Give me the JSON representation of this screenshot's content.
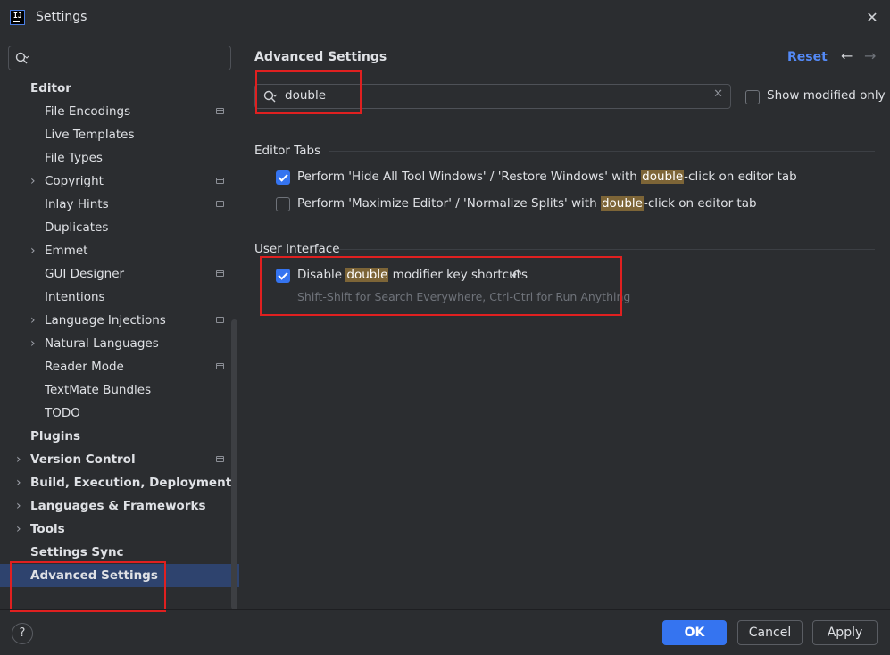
{
  "window": {
    "title": "Settings",
    "logo_text": "IJ"
  },
  "sidebar": {
    "search_placeholder": "",
    "items": [
      {
        "label": "Editor",
        "level": 0,
        "bold": true,
        "chevron": false,
        "project": false
      },
      {
        "label": "File Encodings",
        "level": 1,
        "bold": false,
        "chevron": false,
        "project": true
      },
      {
        "label": "Live Templates",
        "level": 1,
        "bold": false,
        "chevron": false,
        "project": false
      },
      {
        "label": "File Types",
        "level": 1,
        "bold": false,
        "chevron": false,
        "project": false
      },
      {
        "label": "Copyright",
        "level": 1,
        "bold": false,
        "chevron": true,
        "project": true
      },
      {
        "label": "Inlay Hints",
        "level": 1,
        "bold": false,
        "chevron": false,
        "project": true
      },
      {
        "label": "Duplicates",
        "level": 1,
        "bold": false,
        "chevron": false,
        "project": false
      },
      {
        "label": "Emmet",
        "level": 1,
        "bold": false,
        "chevron": true,
        "project": false
      },
      {
        "label": "GUI Designer",
        "level": 1,
        "bold": false,
        "chevron": false,
        "project": true
      },
      {
        "label": "Intentions",
        "level": 1,
        "bold": false,
        "chevron": false,
        "project": false
      },
      {
        "label": "Language Injections",
        "level": 1,
        "bold": false,
        "chevron": true,
        "project": true
      },
      {
        "label": "Natural Languages",
        "level": 1,
        "bold": false,
        "chevron": true,
        "project": false
      },
      {
        "label": "Reader Mode",
        "level": 1,
        "bold": false,
        "chevron": false,
        "project": true
      },
      {
        "label": "TextMate Bundles",
        "level": 1,
        "bold": false,
        "chevron": false,
        "project": false
      },
      {
        "label": "TODO",
        "level": 1,
        "bold": false,
        "chevron": false,
        "project": false
      },
      {
        "label": "Plugins",
        "level": 0,
        "bold": true,
        "chevron": false,
        "project": false
      },
      {
        "label": "Version Control",
        "level": 0,
        "bold": true,
        "chevron": true,
        "project": true
      },
      {
        "label": "Build, Execution, Deployment",
        "level": 0,
        "bold": true,
        "chevron": true,
        "project": false
      },
      {
        "label": "Languages & Frameworks",
        "level": 0,
        "bold": true,
        "chevron": true,
        "project": false
      },
      {
        "label": "Tools",
        "level": 0,
        "bold": true,
        "chevron": true,
        "project": false
      },
      {
        "label": "Settings Sync",
        "level": 0,
        "bold": true,
        "chevron": false,
        "project": false
      },
      {
        "label": "Advanced Settings",
        "level": 0,
        "bold": true,
        "chevron": false,
        "project": false,
        "selected": true
      }
    ]
  },
  "main": {
    "heading": "Advanced Settings",
    "reset": "Reset",
    "search": {
      "value": "double"
    },
    "show_modified_only": {
      "label": "Show modified only",
      "checked": false
    },
    "groups": {
      "editor_tabs": {
        "title": "Editor Tabs",
        "opt1": {
          "checked": true,
          "before": "Perform 'Hide All Tool Windows' / 'Restore Windows' with ",
          "match": "double",
          "after": "-click on editor tab"
        },
        "opt2": {
          "checked": false,
          "before": "Perform 'Maximize Editor' / 'Normalize Splits' with ",
          "match": "double",
          "after": "-click on editor tab"
        }
      },
      "user_interface": {
        "title": "User Interface",
        "opt1": {
          "checked": true,
          "before": "Disable ",
          "match": "double",
          "after": " modifier key shortcuts",
          "hint": "Shift-Shift for Search Everywhere, Ctrl-Ctrl for Run Anything"
        }
      }
    }
  },
  "footer": {
    "help": "?",
    "ok": "OK",
    "cancel": "Cancel",
    "apply": "Apply"
  },
  "colors": {
    "accent": "#3574f0",
    "link": "#548af7",
    "highlight": "#7d6537",
    "annotation_box": "#e02020",
    "selection": "#2e436e"
  }
}
